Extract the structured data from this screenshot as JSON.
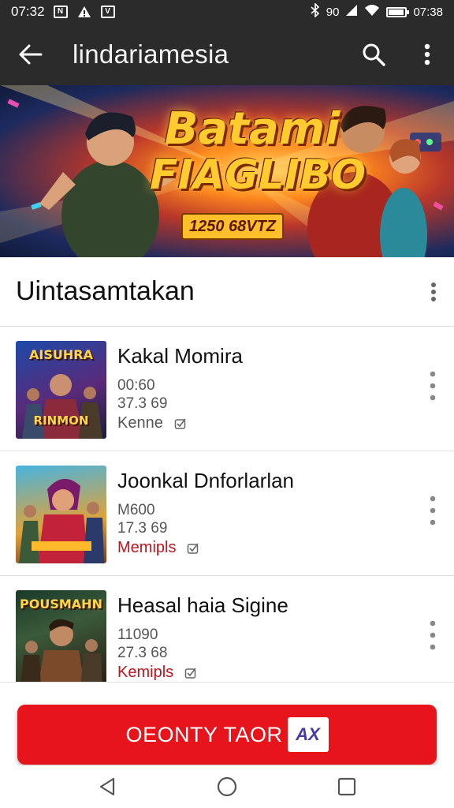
{
  "status_bar": {
    "time_left": "07:32",
    "time_right": "07:38",
    "network_text": "90",
    "battery_level": 0.95,
    "icons": [
      "app-n-icon",
      "warning-icon",
      "app-v-icon",
      "bluetooth-icon",
      "vibrate-icon",
      "signal-icon",
      "wifi-icon",
      "battery-icon"
    ]
  },
  "app_bar": {
    "title": "lindariamesia",
    "back_icon": "arrow-left-icon",
    "search_icon": "search-icon",
    "overflow_icon": "more-vert-icon"
  },
  "banner": {
    "line1": "Batami",
    "line2": "FIAGLIBO",
    "subtitle": "1250 68VTZ"
  },
  "section": {
    "title": "Uintasamtakan"
  },
  "list": [
    {
      "thumb_label": "AISUHRA",
      "thumb_label_bottom": "RINMON",
      "title": "Kakal Momira",
      "meta1": "00:60",
      "meta2": "37.3 69",
      "tag": "Kenne",
      "tag_color": "#555555"
    },
    {
      "thumb_label": "",
      "thumb_label_bottom": "",
      "title": "Joonkal Dnforlarlan",
      "meta1": "M600",
      "meta2": "17.3 69",
      "tag": "Memipls",
      "tag_color": "#c2121b"
    },
    {
      "thumb_label": "POUSMAHN",
      "thumb_label_bottom": "",
      "title": "Heasal haia Sigine",
      "meta1": "11090",
      "meta2": "27.3 68",
      "tag": "Kemipls",
      "tag_color": "#c2121b"
    }
  ],
  "cta": {
    "label": "OEONTY TAOR",
    "badge": "AX",
    "color": "#e8141b"
  },
  "nav": {
    "back_icon": "nav-back-icon",
    "home_icon": "nav-home-icon",
    "recents_icon": "nav-recents-icon"
  }
}
